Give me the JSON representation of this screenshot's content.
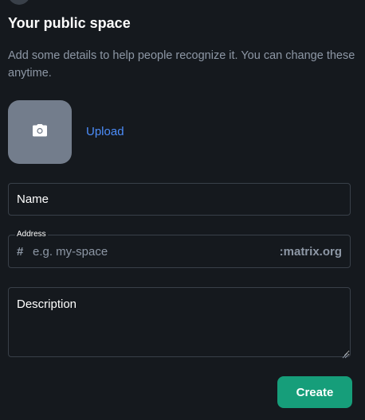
{
  "dialog": {
    "title": "Your public space",
    "subtitle": "Add some details to help people recognize it. You can change these anytime."
  },
  "avatar": {
    "icon": "camera-icon",
    "upload_label": "Upload"
  },
  "form": {
    "name_placeholder": "Name",
    "address_label": "Address",
    "address_prefix": "#",
    "address_placeholder": "e.g. my-space",
    "address_domain": ":matrix.org",
    "description_placeholder": "Description"
  },
  "actions": {
    "create_label": "Create"
  },
  "colors": {
    "background": "#15191e",
    "border": "#394049",
    "muted_text": "#8d97a5",
    "link": "#4c8dfa",
    "primary_button": "#169e7a"
  }
}
